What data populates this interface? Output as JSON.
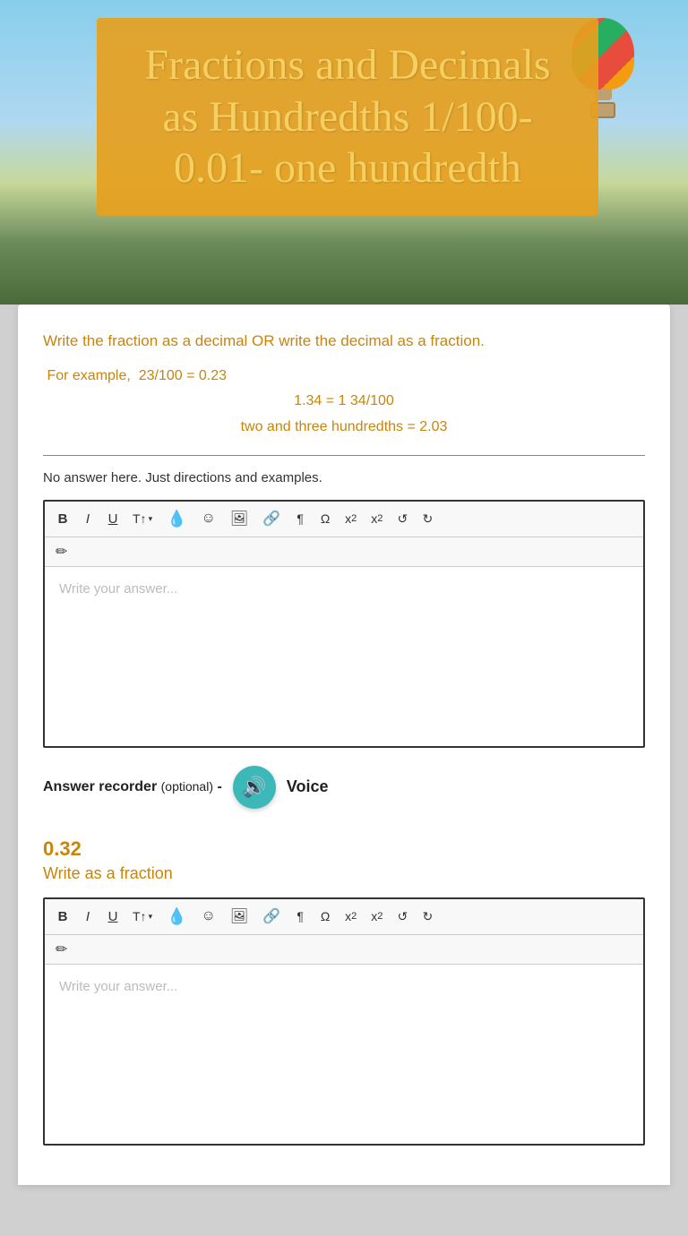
{
  "hero": {
    "title": "Fractions and Decimals as Hundredths 1/100- 0.01- one hundredth"
  },
  "directions": {
    "line1": "Write the fraction as a decimal OR write the decimal as a fraction.",
    "example_label": "For example,",
    "example1": "23/100 = 0.23",
    "example2": "1.34 = 1   34/100",
    "example3": "two and three hundredths =  2.03"
  },
  "no_answer_text": "No answer here. Just directions and examples.",
  "toolbar": {
    "bold": "B",
    "italic": "I",
    "underline": "U",
    "font_size": "T↑",
    "color": "●",
    "emoji": "☺",
    "image": "▣",
    "link": "⛓",
    "paragraph": "¶",
    "omega": "Ω",
    "subscript": "x₂",
    "superscript": "x²",
    "undo": "↺",
    "redo": "↻",
    "eraser": "✏"
  },
  "answer_placeholder": "Write your answer...",
  "recorder": {
    "label": "Answer recorder",
    "optional": "(optional)",
    "dash": "-",
    "voice_label": "Voice"
  },
  "question1": {
    "value": "0.32",
    "prompt": "Write as a fraction"
  },
  "question2": {
    "answer_placeholder": "Write your answer..."
  }
}
